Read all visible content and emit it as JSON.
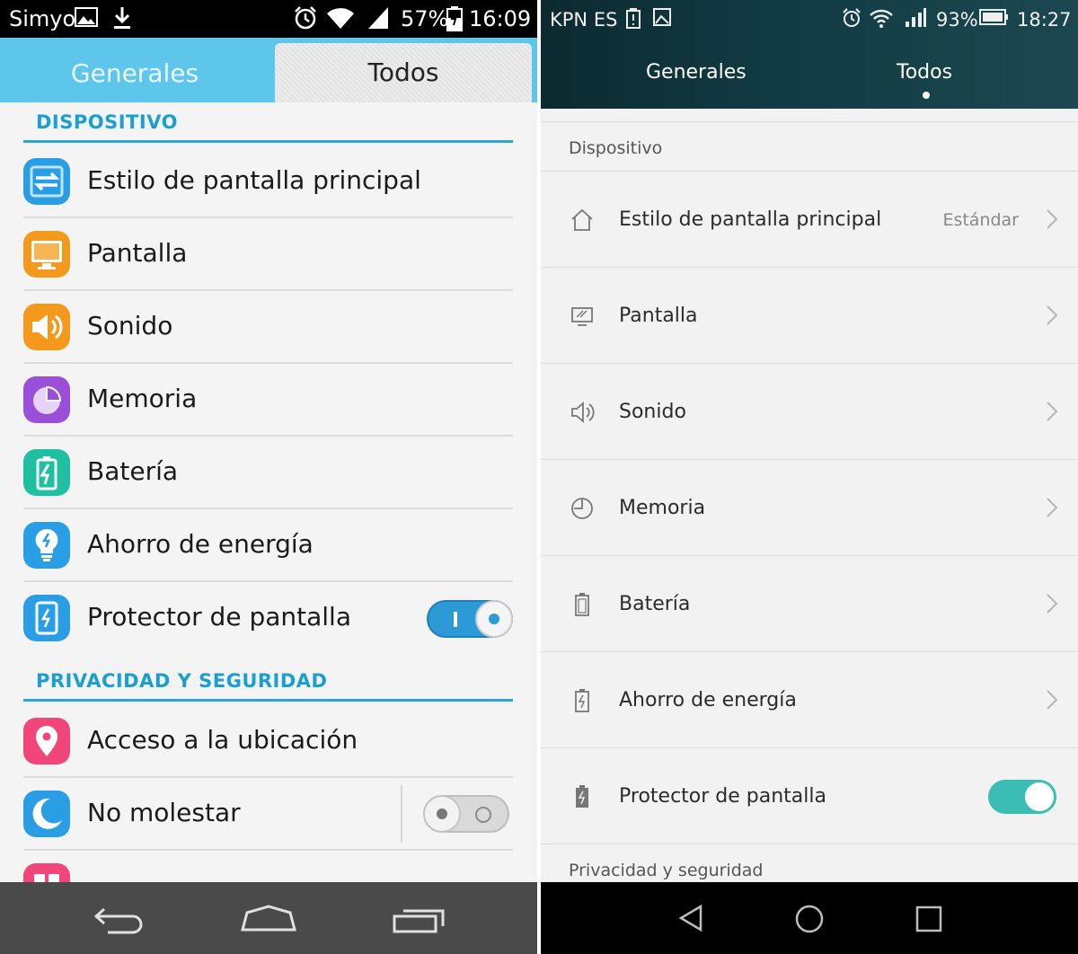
{
  "left": {
    "status": {
      "carrier": "Simyo",
      "battery": "57%",
      "time": "16:09"
    },
    "tabs": [
      {
        "label": "Generales"
      },
      {
        "label": "Todos"
      }
    ],
    "sections": [
      {
        "title": "DISPOSITIVO"
      },
      {
        "title": "PRIVACIDAD Y SEGURIDAD"
      }
    ],
    "items": [
      {
        "label": "Estilo de pantalla principal",
        "icon": "home-style-icon",
        "color": "#2a9ee4"
      },
      {
        "label": "Pantalla",
        "icon": "display-icon",
        "color": "#f39a1c"
      },
      {
        "label": "Sonido",
        "icon": "speaker-icon",
        "color": "#f39a1c"
      },
      {
        "label": "Memoria",
        "icon": "pie-chart-icon",
        "color": "#9a4fd8"
      },
      {
        "label": "Batería",
        "icon": "battery-icon",
        "color": "#1fbfa2"
      },
      {
        "label": "Ahorro de energía",
        "icon": "lightbulb-icon",
        "color": "#2a9ee4"
      },
      {
        "label": "Protector de pantalla",
        "icon": "screen-protector-icon",
        "color": "#2a9ee4",
        "toggle": "on"
      },
      {
        "label": "Acceso a la ubicación",
        "icon": "location-icon",
        "color": "#f0467a"
      },
      {
        "label": "No molestar",
        "icon": "moon-icon",
        "color": "#2a9ee4",
        "toggle": "off"
      }
    ]
  },
  "right": {
    "status": {
      "carrier": "KPN ES",
      "battery": "93%",
      "time": "18:27"
    },
    "tabs": [
      {
        "label": "Generales"
      },
      {
        "label": "Todos"
      }
    ],
    "sections": [
      {
        "title": "Dispositivo"
      },
      {
        "title": "Privacidad y seguridad"
      }
    ],
    "items": [
      {
        "label": "Estilo de pantalla principal",
        "value": "Estándar",
        "icon": "home-icon"
      },
      {
        "label": "Pantalla",
        "icon": "display-icon"
      },
      {
        "label": "Sonido",
        "icon": "speaker-icon"
      },
      {
        "label": "Memoria",
        "icon": "clock-pie-icon"
      },
      {
        "label": "Batería",
        "icon": "battery-icon"
      },
      {
        "label": "Ahorro de energía",
        "icon": "power-saving-icon"
      },
      {
        "label": "Protector de pantalla",
        "icon": "screen-protector-icon",
        "toggle": "on"
      }
    ]
  },
  "colors": {
    "left_accent": "#2aa6d4",
    "left_tab_bar": "#5ec6ea",
    "right_toggle": "#3bbdb6",
    "right_header": "#123b44"
  }
}
